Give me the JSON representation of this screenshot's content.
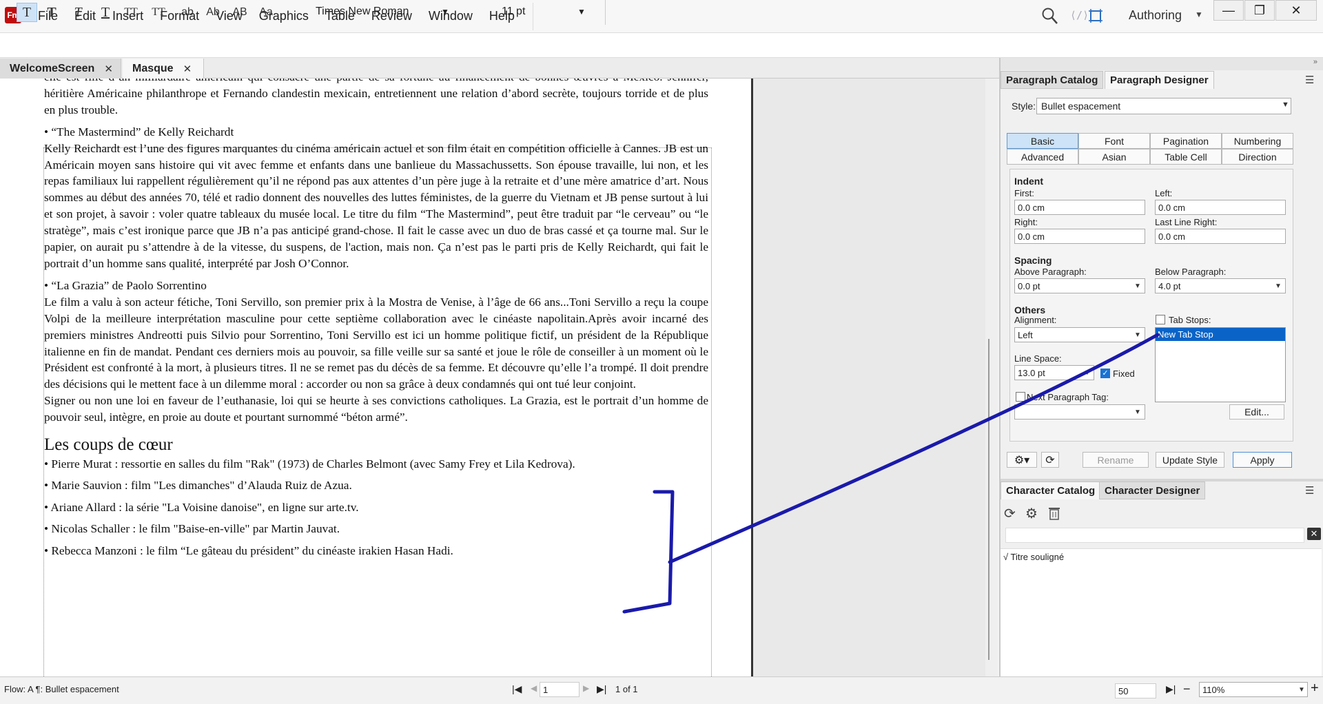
{
  "app": {
    "logo": "Fm",
    "menus": [
      "File",
      "Edit",
      "Insert",
      "Format",
      "View",
      "Graphics",
      "Table",
      "Review",
      "Window",
      "Help"
    ],
    "workspace": "Authoring",
    "window_buttons": [
      "—",
      "❐",
      "✕"
    ]
  },
  "format_bar": {
    "buttons": [
      "T",
      "T",
      "T",
      "T",
      "TT",
      "TT",
      "ab",
      "Ab",
      "AB",
      "Aa"
    ],
    "font": "Times New Roman",
    "size": "11 pt"
  },
  "tabs": [
    {
      "label": "WelcomeScreen",
      "close": "✕"
    },
    {
      "label": "Masque",
      "close": "✕"
    }
  ],
  "document": {
    "paragraphs": [
      {
        "text": "elle est fille d’un milliardaire américain qui consacre une partie de sa fortune au financement de bonnes œuvres à Mexico. Jennifer, héritière Américaine philanthrope et Fernando clandestin mexicain, entretiennent une relation d’abord secrète, toujours torride et de plus en plus trouble."
      },
      {
        "text": "•  “The Mastermind” de Kelly Reichardt"
      },
      {
        "text": "Kelly Reichardt est l’une des figures marquantes du cinéma américain actuel et son film était en compétition officielle à Cannes. JB est un Américain moyen sans histoire qui vit avec femme et enfants dans une banlieue du Massachussetts. Son épouse travaille, lui non, et les repas familiaux lui rappellent régulièrement qu’il ne répond pas aux attentes d’un père juge à la retraite et d’une mère amatrice d’art. Nous sommes au début des années 70, télé et radio donnent des nouvelles des luttes féministes, de la guerre du Vietnam et JB pense surtout à lui et son projet, à savoir : voler quatre tableaux du musée local. Le titre du film “The Mastermind”, peut être traduit par “le cerveau” ou “le stratège”, mais c’est ironique parce que JB n’a pas anticipé grand-chose. Il fait le casse avec un duo de bras cassé et ça tourne mal. Sur le papier, on aurait pu s’attendre à de la vitesse, du suspens, de l'action, mais non. Ça n’est pas le parti pris de Kelly Reichardt, qui fait le portrait d’un homme sans qualité, interprété par Josh O’Connor."
      },
      {
        "text": "•  “La Grazia” de Paolo Sorrentino"
      },
      {
        "text": "Le film a valu à son acteur fétiche, Toni Servillo, son premier prix à la Mostra de Venise, à l’âge de 66 ans...Toni Servillo a reçu la coupe Volpi de la meilleure interprétation masculine pour cette septième collaboration avec le cinéaste napolitain.Après avoir incarné des premiers ministres Andreotti puis Silvio pour Sorrentino, Toni Servillo est ici un homme politique fictif, un président de la République italienne en fin de mandat. Pendant ces derniers mois au pouvoir, sa fille veille sur sa santé et joue le rôle de conseiller à un moment où le Président est confronté à la mort, à plusieurs titres. Il ne se remet pas du décès de sa femme. Et découvre qu’elle l’a trompé. Il doit prendre des décisions qui le mettent face à un dilemme moral : accorder ou non sa grâce à deux condamnés qui ont tué leur conjoint."
      },
      {
        "text": "Signer ou non une loi en faveur de l’euthanasie, loi qui se heurte à ses convictions catholiques. La Grazia, est le portrait d’un homme de pouvoir seul, intègre, en proie au doute et pourtant surnommé “béton armé”."
      }
    ],
    "heading": "Les coups de cœur",
    "bullets": [
      "•  Pierre Murat : ressortie en salles du film \"Rak\" (1973) de Charles Belmont (avec Samy Frey et Lila Kedrova).",
      "•  Marie Sauvion : film \"Les dimanches\" d’Alauda Ruiz de Azua.",
      "•  Ariane Allard : la série \"La Voisine danoise\", en ligne sur arte.tv.",
      "•  Nicolas Schaller : le film \"Baise-en-ville\" par Martin Jauvat.",
      "•  Rebecca Manzoni : le film “Le gâteau du président” du cinéaste irakien Hasan Hadi."
    ]
  },
  "paragraph_panel": {
    "tabs": [
      "Paragraph Catalog",
      "Paragraph Designer"
    ],
    "style_label": "Style:",
    "style_value": "Bullet espacement",
    "prop_tabs": [
      "Basic",
      "Font",
      "Pagination",
      "Numbering",
      "Advanced",
      "Asian",
      "Table Cell",
      "Direction"
    ],
    "indent": {
      "title": "Indent",
      "first_label": "First:",
      "first": "0.0 cm",
      "left_label": "Left:",
      "left": "0.0 cm",
      "right_label": "Right:",
      "right": "0.0 cm",
      "lastright_label": "Last Line Right:",
      "lastright": "0.0 cm"
    },
    "spacing": {
      "title": "Spacing",
      "above_label": "Above Paragraph:",
      "above": "0.0 pt",
      "below_label": "Below Paragraph:",
      "below": "4.0 pt"
    },
    "others": {
      "title": "Others",
      "alignment_label": "Alignment:",
      "alignment": "Left",
      "tabstops_label": "Tab Stops:",
      "tabstop_item": "New Tab Stop",
      "linespace_label": "Line Space:",
      "linespace": "13.0 pt",
      "fixed_label": "Fixed",
      "nexttag_label": "Next Paragraph Tag:",
      "edit": "Edit..."
    },
    "bottom": {
      "rename": "Rename",
      "update": "Update Style",
      "apply": "Apply"
    }
  },
  "character_panel": {
    "tabs": [
      "Character Catalog",
      "Character Designer"
    ],
    "items": [
      "√ Titre souligné"
    ]
  },
  "status": {
    "flow": "Flow: A  ¶: Bullet espacement",
    "page": "1",
    "page_of": "1 of 1",
    "zoom_num": "50",
    "zoom": "110%"
  },
  "colors": {
    "selection": "#0a64c8",
    "annotation": "#1a1aaa",
    "active_tab": "#cde3f7"
  }
}
